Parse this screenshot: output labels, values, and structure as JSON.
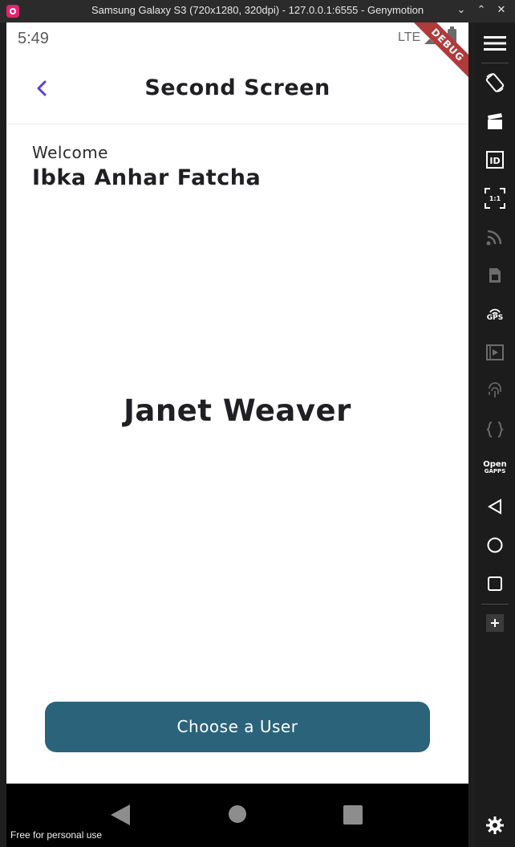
{
  "window": {
    "title": "Samsung Galaxy S3 (720x1280, 320dpi) - 127.0.0.1:6555 - Genymotion",
    "controls": [
      "chevron-down",
      "chevron-up",
      "close"
    ]
  },
  "status_bar": {
    "time": "5:49",
    "network": "LTE"
  },
  "debug_banner": "DEBUG",
  "app_bar": {
    "title": "Second Screen"
  },
  "content": {
    "welcome_label": "Welcome",
    "user_name": "Ibka Anhar Fatcha",
    "selected_user": "Janet Weaver",
    "choose_button_label": "Choose a User"
  },
  "colors": {
    "accent": "#5b3fd6",
    "button": "#2b637b",
    "text_dark": "#1f1f24"
  },
  "footer": {
    "license_text": "Free for personal use"
  },
  "toolbar": {
    "gps_label": "GPS",
    "gapps_label_top": "Open",
    "gapps_label_bottom": "GAPPS",
    "scale_label": "1:1",
    "items": [
      "menu-icon",
      "rotate-icon",
      "camera-clapper-icon",
      "id-icon",
      "scale-icon",
      "cast-icon",
      "sim-icon",
      "gps-icon",
      "media-icon",
      "fingerprint-icon",
      "code-braces-icon",
      "open-gapps-icon",
      "back-icon",
      "home-icon",
      "recent-apps-icon",
      "plus-icon",
      "settings-icon"
    ]
  }
}
